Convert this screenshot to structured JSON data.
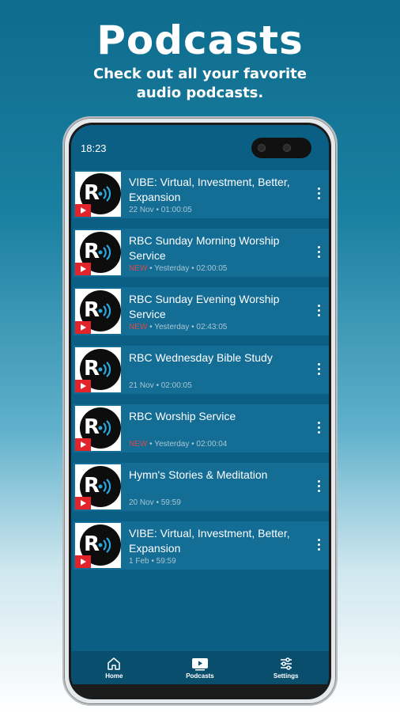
{
  "hero": {
    "title": "Podcasts",
    "subtitle_line1": "Check out all your favorite",
    "subtitle_line2": "audio podcasts."
  },
  "status_bar": {
    "time": "18:23"
  },
  "podcasts": [
    {
      "title": "VIBE: Virtual, Investment, Better, Expansion",
      "badge": "",
      "date": "22 Nov",
      "duration": "01:00:05"
    },
    {
      "title": "RBC Sunday Morning Worship Service",
      "badge": "NEW",
      "date": "Yesterday",
      "duration": "02:00:05"
    },
    {
      "title": "RBC Sunday Evening Worship Service",
      "badge": "NEW",
      "date": "Yesterday",
      "duration": "02:43:05"
    },
    {
      "title": "RBC Wednesday Bible Study",
      "badge": "",
      "date": "21 Nov",
      "duration": "02:00:05"
    },
    {
      "title": "RBC Worship Service",
      "badge": "NEW",
      "date": "Yesterday",
      "duration": "02:00:04"
    },
    {
      "title": "Hymn's Stories & Meditation",
      "badge": "",
      "date": "20 Nov",
      "duration": "59:59"
    },
    {
      "title": "VIBE: Virtual, Investment, Better, Expansion",
      "badge": "",
      "date": "1 Feb",
      "duration": "59:59"
    }
  ],
  "thumbnail_letter": "R",
  "bottom_nav": {
    "home": "Home",
    "podcasts": "Podcasts",
    "settings": "Settings"
  },
  "colors": {
    "screen_bg": "#0b5f84",
    "row_bg": "#136d95",
    "nav_bg": "#0a4e6e",
    "play_badge": "#e2232a"
  }
}
